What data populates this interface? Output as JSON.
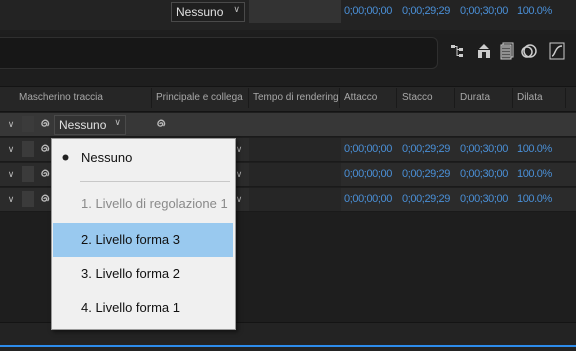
{
  "headers": {
    "mask": "Mascherino traccia",
    "parent": "Principale e collega",
    "render": "Tempo di rendering",
    "in": "Attacco",
    "out": "Stacco",
    "duration": "Durata",
    "stretch": "Dilata"
  },
  "rows": [
    {
      "mask_value": "Nessuno",
      "parent_value": "Nessuno",
      "in": "0;00;00;00",
      "out": "0;00;29;29",
      "duration": "0;00;30;00",
      "stretch": "100.0%"
    },
    {
      "in": "0;00;00;00",
      "out": "0;00;29;29",
      "duration": "0;00;30;00",
      "stretch": "100.0%"
    },
    {
      "in": "0;00;00;00",
      "out": "0;00;29;29",
      "duration": "0;00;30;00",
      "stretch": "100.0%"
    },
    {
      "in": "0;00;00;00",
      "out": "0;00;29;29",
      "duration": "0;00;30;00",
      "stretch": "100.0%"
    }
  ],
  "menu": {
    "items": [
      {
        "label": "Nessuno",
        "checked": true,
        "disabled": false,
        "highlighted": false
      },
      {
        "label": "1. Livello di regolazione 1",
        "checked": false,
        "disabled": true,
        "highlighted": false
      },
      {
        "label": "2. Livello forma 3",
        "checked": false,
        "disabled": false,
        "highlighted": true
      },
      {
        "label": "3. Livello forma 2",
        "checked": false,
        "disabled": false,
        "highlighted": false
      },
      {
        "label": "4. Livello forma 1",
        "checked": false,
        "disabled": false,
        "highlighted": false
      }
    ]
  },
  "toolbar_icons": [
    "flowchart-icon",
    "shy-icon",
    "frame-blending-icon",
    "motion-blur-icon",
    "graph-editor-icon"
  ],
  "colors": {
    "timecode": "#4a8fd6",
    "menu_highlight": "#99c9ef",
    "accent_line": "#2d8ceb"
  }
}
